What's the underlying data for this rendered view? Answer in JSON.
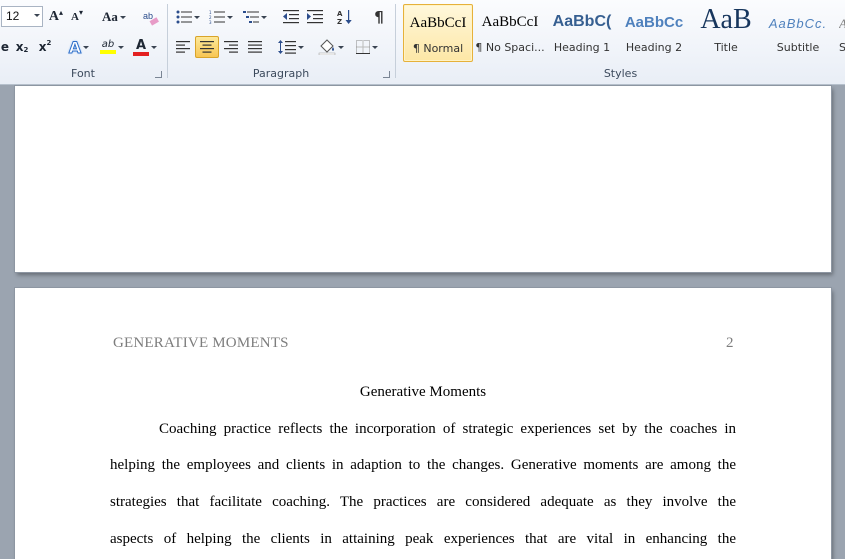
{
  "ribbon": {
    "font": {
      "size_value": "12",
      "label": "Font"
    },
    "paragraph": {
      "label": "Paragraph"
    },
    "styles": {
      "label": "Styles",
      "items": [
        {
          "sample": "AaBbCcI",
          "name": "¶ Normal"
        },
        {
          "sample": "AaBbCcI",
          "name": "¶ No Spaci..."
        },
        {
          "sample": "AaBbC(",
          "name": "Heading 1"
        },
        {
          "sample": "AaBbCc",
          "name": "Heading 2"
        },
        {
          "sample": "AaB",
          "name": "Title"
        },
        {
          "sample": "AaBbCc.",
          "name": "Subtitle"
        },
        {
          "sample": "A",
          "name": "S"
        }
      ]
    },
    "font_buttons": {
      "grow_font": "A",
      "shrink_font": "A",
      "change_case": "Aa",
      "bold_partial": "e",
      "subscript": "x",
      "superscript": "x",
      "text_effects": "A",
      "highlight": "ab",
      "font_color": "A"
    },
    "colors": {
      "highlight": "#ffff00",
      "font_color": "#e32020",
      "accent": "#2b579a"
    }
  },
  "document": {
    "header_title": "GENERATIVE MOMENTS",
    "header_page_number": "2",
    "title": "Generative Moments",
    "lines": [
      "Coaching practice reflects the incorporation of strategic experiences set by the coaches in",
      "helping the employees and clients in adaption to the changes. Generative moments are among the",
      "strategies that facilitate coaching. The practices are considered adequate as they involve the",
      "aspects of helping the clients in attaining peak experiences that are vital in enhancing the"
    ]
  }
}
